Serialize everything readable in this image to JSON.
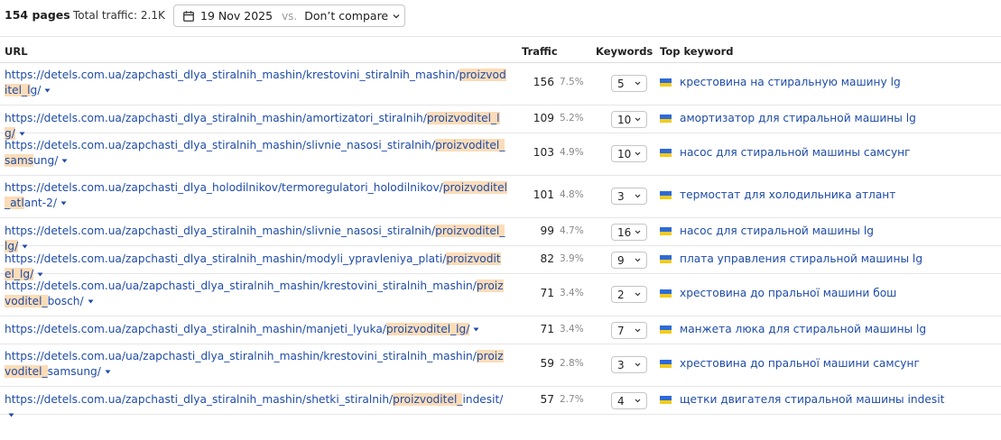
{
  "header": {
    "pages_label": "154 pages",
    "total_traffic_label": "Total traffic: 2.1K",
    "date_label": "19 Nov 2025",
    "vs_label": "vs.",
    "compare_label": "Don’t compare"
  },
  "table": {
    "columns": {
      "url": "URL",
      "traffic": "Traffic",
      "keywords": "Keywords",
      "top_keyword": "Top keyword"
    },
    "rows": [
      {
        "url_pre": "https://detels.com.ua/zapchasti_dlya_stiralnih_mashin/krestovini_stiralnih_mashin/",
        "url_hl": "proizvoditel_l",
        "url_post": "g/",
        "traffic": "156",
        "pct": "7.5%",
        "keywords": "5",
        "top_keyword": "крестовина на стиральную машину lg"
      },
      {
        "url_pre": "https://detels.com.ua/zapchasti_dlya_stiralnih_mashin/amortizatori_stiralnih/",
        "url_hl": "proizvoditel_lg/",
        "url_post": "",
        "traffic": "109",
        "pct": "5.2%",
        "keywords": "10",
        "top_keyword": "амортизатор для стиральной машины lg"
      },
      {
        "url_pre": "https://detels.com.ua/zapchasti_dlya_stiralnih_mashin/slivnie_nasosi_stiralnih/",
        "url_hl": "proizvoditel_sams",
        "url_post": "ung/",
        "traffic": "103",
        "pct": "4.9%",
        "keywords": "10",
        "top_keyword": "насос для стиральной машины самсунг"
      },
      {
        "url_pre": "https://detels.com.ua/zapchasti_dlya_holodilnikov/termoregulatori_holodilnikov/",
        "url_hl": "proizvoditel_atl",
        "url_post": "ant-2/",
        "traffic": "101",
        "pct": "4.8%",
        "keywords": "3",
        "top_keyword": "термостат для холодильника атлант"
      },
      {
        "url_pre": "https://detels.com.ua/zapchasti_dlya_stiralnih_mashin/slivnie_nasosi_stiralnih/",
        "url_hl": "proizvoditel_lg/",
        "url_post": "",
        "traffic": "99",
        "pct": "4.7%",
        "keywords": "16",
        "top_keyword": "насос для стиральной машины lg"
      },
      {
        "url_pre": "https://detels.com.ua/zapchasti_dlya_stiralnih_mashin/modyli_ypravleniya_plati/",
        "url_hl": "proizvoditel_lg/",
        "url_post": "",
        "traffic": "82",
        "pct": "3.9%",
        "keywords": "9",
        "top_keyword": "плата управления стиральной машины lg"
      },
      {
        "url_pre": "https://detels.com.ua/ua/zapchasti_dlya_stiralnih_mashin/krestovini_stiralnih_mashin/",
        "url_hl": "proizvoditel_",
        "url_post": "bosch/",
        "traffic": "71",
        "pct": "3.4%",
        "keywords": "2",
        "top_keyword": "хрестовина до пральної машини бош"
      },
      {
        "url_pre": "https://detels.com.ua/zapchasti_dlya_stiralnih_mashin/manjeti_lyuka/",
        "url_hl": "proizvoditel_lg/",
        "url_post": "",
        "traffic": "71",
        "pct": "3.4%",
        "keywords": "7",
        "top_keyword": "манжета люка для стиральной машины lg"
      },
      {
        "url_pre": "https://detels.com.ua/ua/zapchasti_dlya_stiralnih_mashin/krestovini_stiralnih_mashin/",
        "url_hl": "proizvoditel_",
        "url_post": "samsung/",
        "traffic": "59",
        "pct": "2.8%",
        "keywords": "3",
        "top_keyword": "хрестовина до пральної машини самсунг"
      },
      {
        "url_pre": "https://detels.com.ua/zapchasti_dlya_stiralnih_mashin/shetki_stiralnih/",
        "url_hl": "proizvoditel_",
        "url_post": "indesit/",
        "traffic": "57",
        "pct": "2.7%",
        "keywords": "4",
        "top_keyword": "щетки двигателя стиральной машины indesit"
      }
    ]
  },
  "colors": {
    "link": "#1f4ca8",
    "highlight": "#fbdcb8",
    "flag_blue": "#2f6bd6",
    "flag_yellow": "#f2cb1a"
  },
  "icons": {
    "calendar": "calendar-icon",
    "chevron": "chevron-down-icon",
    "caret": "caret-down-icon",
    "flag": "ukraine-flag-icon"
  }
}
